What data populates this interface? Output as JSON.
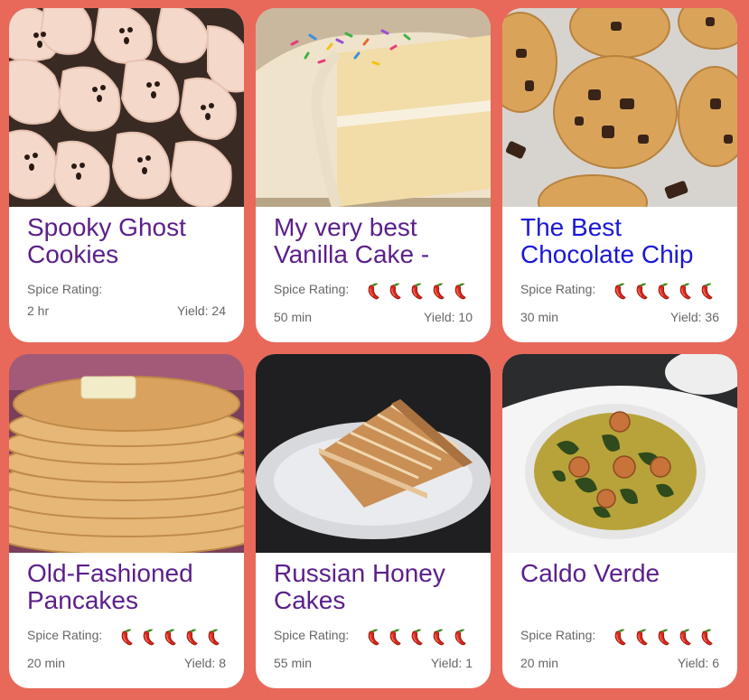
{
  "spice_label": "Spice Rating:",
  "colors": {
    "background": "#e8695a",
    "card": "#ffffff",
    "title": "#5b1f8a",
    "title_link_active": "#1a17d6",
    "meta_text": "#666666",
    "pepper_red": "#d9281a",
    "pepper_stem": "#3c8a1e"
  },
  "recipes": [
    {
      "title": "Spooky Ghost Cookies",
      "spice_rating": 0,
      "time": "2 hr",
      "yield": "Yield: 24",
      "image": "ghost-cookies-photo"
    },
    {
      "title": "My very best Vanilla Cake -",
      "spice_rating": 5,
      "time": "50 min",
      "yield": "Yield: 10",
      "image": "vanilla-cake-photo"
    },
    {
      "title": "The Best Chocolate Chip",
      "spice_rating": 5,
      "time": "30 min",
      "yield": "Yield: 36",
      "image": "chocolate-chip-cookies-photo"
    },
    {
      "title": "Old-Fashioned Pancakes",
      "spice_rating": 5,
      "time": "20 min",
      "yield": "Yield: 8",
      "image": "pancakes-photo"
    },
    {
      "title": "Russian Honey Cakes",
      "spice_rating": 5,
      "time": "55 min",
      "yield": "Yield: 1",
      "image": "honey-cake-photo"
    },
    {
      "title": "Caldo Verde",
      "spice_rating": 5,
      "time": "20 min",
      "yield": "Yield: 6",
      "image": "caldo-verde-soup-photo"
    }
  ]
}
